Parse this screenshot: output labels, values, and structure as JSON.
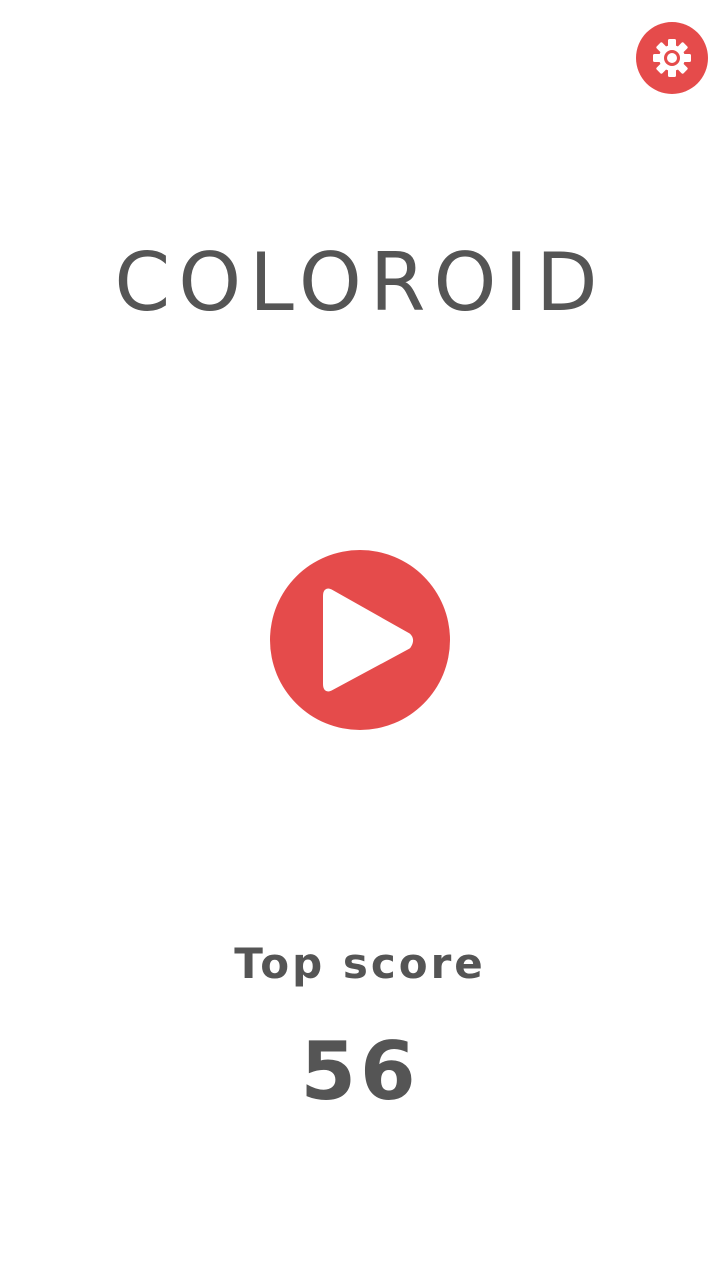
{
  "app": {
    "title": "COLOROID"
  },
  "controls": {
    "settings_icon": "gear-icon",
    "play_icon": "play-icon"
  },
  "score": {
    "label": "Top score",
    "value": "56"
  },
  "colors": {
    "accent": "#e54b4b",
    "text": "#555555",
    "background": "#ffffff"
  }
}
